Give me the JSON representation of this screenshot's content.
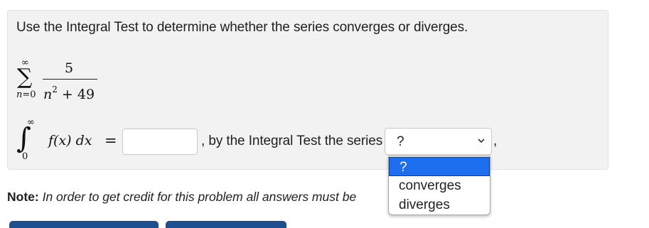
{
  "problem": {
    "prompt": "Use the Integral Test to determine whether the series converges or diverges.",
    "series": {
      "upper_limit": "∞",
      "lower_var": "n",
      "lower_eq": "=",
      "lower_value": "0",
      "numerator": "5",
      "denominator_var": "n",
      "denominator_exp": "2",
      "denominator_rest": " + 49"
    },
    "integral": {
      "upper_limit": "∞",
      "lower_limit": "0",
      "integrand": "f(x) dx",
      "equals": "="
    },
    "answer_input": {
      "value": "",
      "placeholder": ""
    },
    "connector_text": ", by the Integral Test the series",
    "select": {
      "selected_value": "?",
      "options": [
        "?",
        "converges",
        "diverges"
      ],
      "highlighted_index": 0
    },
    "trailing_comma": ","
  },
  "note": {
    "label": "Note:",
    "text": "In order to get credit for this problem all answers must be"
  },
  "colors": {
    "panel_background": "#f2f2f2",
    "option_highlight": "#1e6ff0",
    "button_stub": "#1d4e8f"
  }
}
